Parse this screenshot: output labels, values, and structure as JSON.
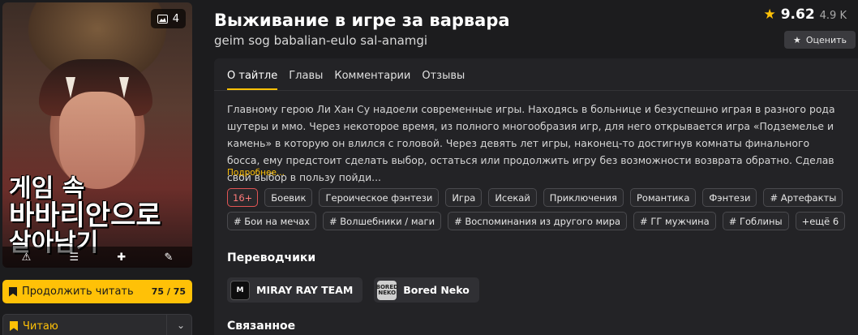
{
  "cover": {
    "gallery_count": "4",
    "title_art": [
      "게임 속",
      "바바리안으로",
      "살아남기"
    ]
  },
  "left": {
    "continue_label": "Продолжить читать",
    "continue_count": "75 / 75",
    "reading_label": "Читаю"
  },
  "header": {
    "title": "Выживание в игре за варвара",
    "subtitle": "geim sog babalian-eulo sal-anamgi",
    "rating": "9.62",
    "votes": "4.9 K",
    "rate_button": "Оценить"
  },
  "tabs": [
    "О тайтле",
    "Главы",
    "Комментарии",
    "Отзывы"
  ],
  "description": "Главному герою Ли Хан Су надоели современные игры. Находясь в больнице и безуспешно играя в разного рода шутеры и ммо. Через некоторое время, из полного многообразия игр, для него открывается игра «Подземелье и камень» в которую он влился с головой. Через девять лет игры, наконец-то достигнув комнаты финального босса, ему предстоит сделать выбор, остаться или продолжить игру без возможности возврата обратно. Сделав свой выбор в пользу пойди...",
  "more_label": "Подробнее...",
  "tags": [
    "16+",
    "Боевик",
    "Героическое фэнтези",
    "Игра",
    "Исекай",
    "Приключения",
    "Романтика",
    "Фэнтези",
    "# Артефакты",
    "# Бои на мечах",
    "# Волшебники / маги",
    "# Воспоминания из другого мира",
    "# ГГ мужчина",
    "# Гоблины",
    "+ещё 6"
  ],
  "translators_title": "Переводчики",
  "translators": [
    {
      "name": "MIRAY RAY TEAM",
      "logo": "M"
    },
    {
      "name": "Bored Neko",
      "logo": "BORED NEKO"
    }
  ],
  "related_title": "Связанное",
  "colors": {
    "accent": "#ffc107",
    "age_badge": "#e25555",
    "background": "#1c1c1e"
  }
}
